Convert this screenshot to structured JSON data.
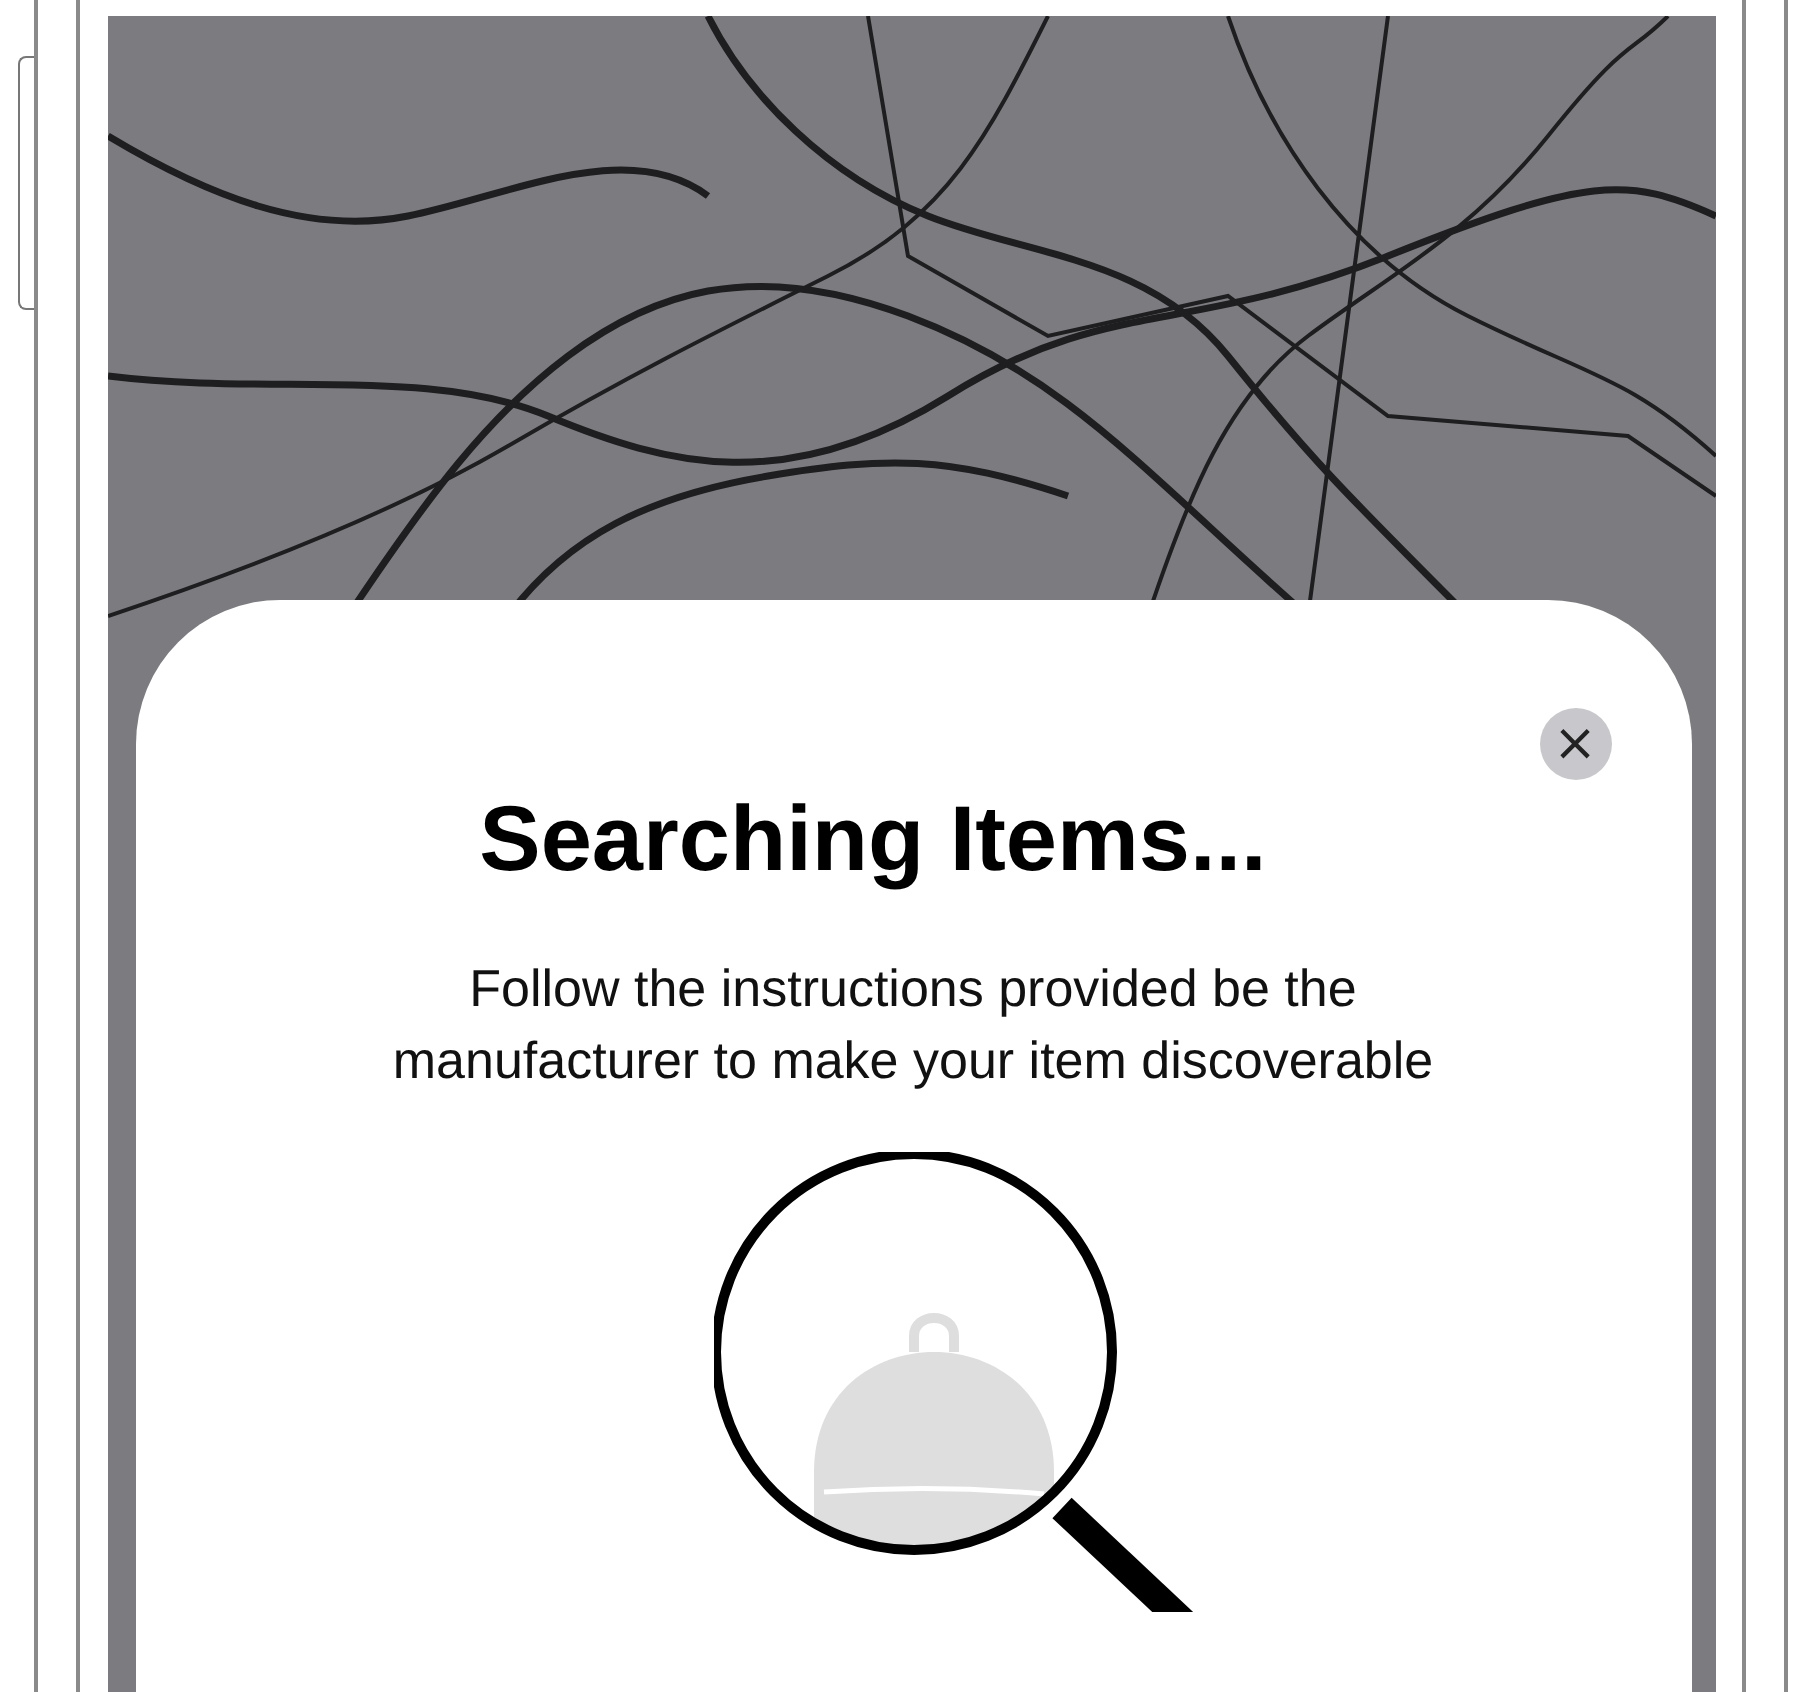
{
  "sheet": {
    "close": "×",
    "title": "Searching Items...",
    "description": "Follow the instructions provided be the manufacturer to make your item discoverable"
  }
}
